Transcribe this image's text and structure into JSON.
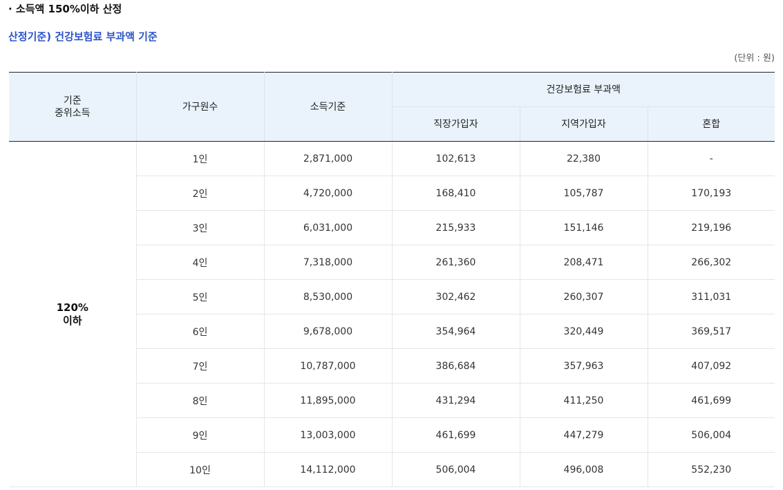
{
  "heading": "· 소득액 150%이하 산정",
  "subheading": "산정기준) 건강보험료 부과액 기준",
  "unit_note": "(단위 : 원)",
  "colors": {
    "subheading": "#2a53c9",
    "header_bg": "#eaf3fb",
    "header_border": "#222222"
  },
  "table": {
    "headers": {
      "median_income_line1": "기준",
      "median_income_line2": "중위소득",
      "household_size": "가구원수",
      "income_standard": "소득기준",
      "premium_group": "건강보험료 부과액",
      "employee": "직장가입자",
      "regional": "지역가입자",
      "mixed": "혼합"
    },
    "tier_line1": "120%",
    "tier_line2": "이하",
    "rows": [
      {
        "size": "1인",
        "income": "2,871,000",
        "employee": "102,613",
        "regional": "22,380",
        "mixed": "-"
      },
      {
        "size": "2인",
        "income": "4,720,000",
        "employee": "168,410",
        "regional": "105,787",
        "mixed": "170,193"
      },
      {
        "size": "3인",
        "income": "6,031,000",
        "employee": "215,933",
        "regional": "151,146",
        "mixed": "219,196"
      },
      {
        "size": "4인",
        "income": "7,318,000",
        "employee": "261,360",
        "regional": "208,471",
        "mixed": "266,302"
      },
      {
        "size": "5인",
        "income": "8,530,000",
        "employee": "302,462",
        "regional": "260,307",
        "mixed": "311,031"
      },
      {
        "size": "6인",
        "income": "9,678,000",
        "employee": "354,964",
        "regional": "320,449",
        "mixed": "369,517"
      },
      {
        "size": "7인",
        "income": "10,787,000",
        "employee": "386,684",
        "regional": "357,963",
        "mixed": "407,092"
      },
      {
        "size": "8인",
        "income": "11,895,000",
        "employee": "431,294",
        "regional": "411,250",
        "mixed": "461,699"
      },
      {
        "size": "9인",
        "income": "13,003,000",
        "employee": "461,699",
        "regional": "447,279",
        "mixed": "506,004"
      },
      {
        "size": "10인",
        "income": "14,112,000",
        "employee": "506,004",
        "regional": "496,008",
        "mixed": "552,230"
      }
    ]
  }
}
